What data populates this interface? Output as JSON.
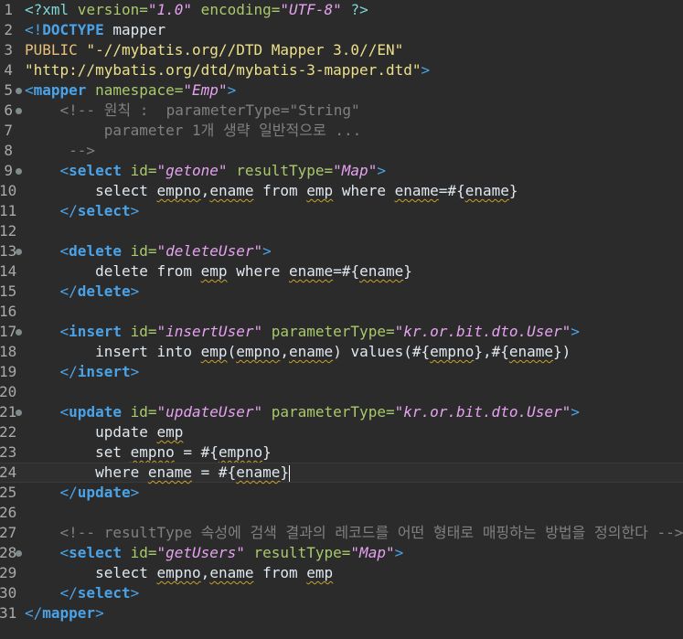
{
  "editor": {
    "lines": [
      {
        "n": "1",
        "fold": false,
        "tokens": [
          {
            "t": "<?",
            "c": "c-pi"
          },
          {
            "t": "xml",
            "c": "c-pi"
          },
          {
            "t": " version=",
            "c": "c-attr"
          },
          {
            "t": "\"1.0\"",
            "c": "c-val"
          },
          {
            "t": " encoding=",
            "c": "c-attr"
          },
          {
            "t": "\"UTF-8\"",
            "c": "c-val"
          },
          {
            "t": " ?>",
            "c": "c-pi"
          }
        ]
      },
      {
        "n": "2",
        "fold": false,
        "tokens": [
          {
            "t": "<!",
            "c": "c-br"
          },
          {
            "t": "DOCTYPE",
            "c": "c-tag"
          },
          {
            "t": " mapper",
            "c": "c-name"
          }
        ]
      },
      {
        "n": "3",
        "fold": false,
        "tokens": [
          {
            "t": "PUBLIC ",
            "c": "c-kw"
          },
          {
            "t": "\"-//mybatis.org//DTD Mapper 3.0//EN\"",
            "c": "c-str"
          }
        ]
      },
      {
        "n": "4",
        "fold": false,
        "tokens": [
          {
            "t": "\"http://mybatis.org/dtd/mybatis-3-mapper.dtd\"",
            "c": "c-str"
          },
          {
            "t": ">",
            "c": "c-br"
          }
        ]
      },
      {
        "n": "5",
        "fold": true,
        "tokens": [
          {
            "t": "<",
            "c": "c-br"
          },
          {
            "t": "mapper",
            "c": "c-tag"
          },
          {
            "t": " namespace=",
            "c": "c-attr"
          },
          {
            "t": "\"Emp\"",
            "c": "c-val"
          },
          {
            "t": ">",
            "c": "c-br"
          }
        ]
      },
      {
        "n": "6",
        "fold": true,
        "tokens": [
          {
            "t": "    <!-- 원칙 :  parameterType=\"String\"",
            "c": "c-cmt"
          }
        ]
      },
      {
        "n": "7",
        "fold": false,
        "tokens": [
          {
            "t": "         parameter 1개 생략 일반적으로 ...",
            "c": "c-cmt"
          }
        ]
      },
      {
        "n": "8",
        "fold": false,
        "tokens": [
          {
            "t": "     -->",
            "c": "c-cmt"
          }
        ]
      },
      {
        "n": "9",
        "fold": true,
        "tokens": [
          {
            "t": "    <",
            "c": "c-br"
          },
          {
            "t": "select",
            "c": "c-tag"
          },
          {
            "t": " id=",
            "c": "c-attr"
          },
          {
            "t": "\"getone\"",
            "c": "c-val"
          },
          {
            "t": " resultType=",
            "c": "c-attr"
          },
          {
            "t": "\"Map\"",
            "c": "c-val"
          },
          {
            "t": ">",
            "c": "c-br"
          }
        ]
      },
      {
        "n": "10",
        "fold": false,
        "tokens": [
          {
            "t": "        select ",
            "c": "c-sql"
          },
          {
            "t": "empno",
            "c": "c-sql u"
          },
          {
            "t": ",",
            "c": "c-sql"
          },
          {
            "t": "ename",
            "c": "c-sql u"
          },
          {
            "t": " from ",
            "c": "c-sql"
          },
          {
            "t": "emp",
            "c": "c-sql u"
          },
          {
            "t": " where ",
            "c": "c-sql"
          },
          {
            "t": "ename",
            "c": "c-sql u"
          },
          {
            "t": "=#{",
            "c": "c-sql"
          },
          {
            "t": "ename",
            "c": "c-sql u"
          },
          {
            "t": "}",
            "c": "c-sql"
          }
        ]
      },
      {
        "n": "11",
        "fold": false,
        "tokens": [
          {
            "t": "    </",
            "c": "c-br"
          },
          {
            "t": "select",
            "c": "c-tag"
          },
          {
            "t": ">",
            "c": "c-br"
          }
        ]
      },
      {
        "n": "12",
        "fold": false,
        "tokens": []
      },
      {
        "n": "13",
        "fold": true,
        "tokens": [
          {
            "t": "    <",
            "c": "c-br"
          },
          {
            "t": "delete",
            "c": "c-tag"
          },
          {
            "t": " id=",
            "c": "c-attr"
          },
          {
            "t": "\"deleteUser\"",
            "c": "c-val"
          },
          {
            "t": ">",
            "c": "c-br"
          }
        ]
      },
      {
        "n": "14",
        "fold": false,
        "tokens": [
          {
            "t": "        delete from ",
            "c": "c-sql"
          },
          {
            "t": "emp",
            "c": "c-sql u"
          },
          {
            "t": " where ",
            "c": "c-sql"
          },
          {
            "t": "ename",
            "c": "c-sql u"
          },
          {
            "t": "=#{",
            "c": "c-sql"
          },
          {
            "t": "ename",
            "c": "c-sql u"
          },
          {
            "t": "}",
            "c": "c-sql"
          }
        ]
      },
      {
        "n": "15",
        "fold": false,
        "tokens": [
          {
            "t": "    </",
            "c": "c-br"
          },
          {
            "t": "delete",
            "c": "c-tag"
          },
          {
            "t": ">",
            "c": "c-br"
          }
        ]
      },
      {
        "n": "16",
        "fold": false,
        "tokens": []
      },
      {
        "n": "17",
        "fold": true,
        "tokens": [
          {
            "t": "    <",
            "c": "c-br"
          },
          {
            "t": "insert",
            "c": "c-tag"
          },
          {
            "t": " id=",
            "c": "c-attr"
          },
          {
            "t": "\"insertUser\"",
            "c": "c-val"
          },
          {
            "t": " parameterType=",
            "c": "c-attr"
          },
          {
            "t": "\"kr.or.bit.dto.User\"",
            "c": "c-val"
          },
          {
            "t": ">",
            "c": "c-br"
          }
        ]
      },
      {
        "n": "18",
        "fold": false,
        "tokens": [
          {
            "t": "        insert into ",
            "c": "c-sql"
          },
          {
            "t": "emp",
            "c": "c-sql u"
          },
          {
            "t": "(",
            "c": "c-sql"
          },
          {
            "t": "empno",
            "c": "c-sql u"
          },
          {
            "t": ",",
            "c": "c-sql"
          },
          {
            "t": "ename",
            "c": "c-sql u"
          },
          {
            "t": ") values(#{",
            "c": "c-sql"
          },
          {
            "t": "empno",
            "c": "c-sql u"
          },
          {
            "t": "},#{",
            "c": "c-sql"
          },
          {
            "t": "ename",
            "c": "c-sql u"
          },
          {
            "t": "})",
            "c": "c-sql"
          }
        ]
      },
      {
        "n": "19",
        "fold": false,
        "tokens": [
          {
            "t": "    </",
            "c": "c-br"
          },
          {
            "t": "insert",
            "c": "c-tag"
          },
          {
            "t": ">",
            "c": "c-br"
          }
        ]
      },
      {
        "n": "20",
        "fold": false,
        "tokens": []
      },
      {
        "n": "21",
        "fold": true,
        "tokens": [
          {
            "t": "    <",
            "c": "c-br"
          },
          {
            "t": "update",
            "c": "c-tag"
          },
          {
            "t": " id=",
            "c": "c-attr"
          },
          {
            "t": "\"updateUser\"",
            "c": "c-val"
          },
          {
            "t": " parameterType=",
            "c": "c-attr"
          },
          {
            "t": "\"kr.or.bit.dto.User\"",
            "c": "c-val"
          },
          {
            "t": ">",
            "c": "c-br"
          }
        ]
      },
      {
        "n": "22",
        "fold": false,
        "tokens": [
          {
            "t": "        update ",
            "c": "c-sql"
          },
          {
            "t": "emp",
            "c": "c-sql u"
          }
        ]
      },
      {
        "n": "23",
        "fold": false,
        "tokens": [
          {
            "t": "        set ",
            "c": "c-sql"
          },
          {
            "t": "empno",
            "c": "c-sql u"
          },
          {
            "t": " = #{",
            "c": "c-sql"
          },
          {
            "t": "empno",
            "c": "c-sql u"
          },
          {
            "t": "}",
            "c": "c-sql"
          }
        ]
      },
      {
        "n": "24",
        "fold": false,
        "current": true,
        "tokens": [
          {
            "t": "        where ",
            "c": "c-sql"
          },
          {
            "t": "ename",
            "c": "c-sql u"
          },
          {
            "t": " = #{",
            "c": "c-sql"
          },
          {
            "t": "ename",
            "c": "c-sql u"
          },
          {
            "t": "}",
            "c": "c-sql"
          }
        ]
      },
      {
        "n": "25",
        "fold": false,
        "tokens": [
          {
            "t": "    </",
            "c": "c-br"
          },
          {
            "t": "update",
            "c": "c-tag"
          },
          {
            "t": ">",
            "c": "c-br"
          }
        ]
      },
      {
        "n": "26",
        "fold": false,
        "tokens": []
      },
      {
        "n": "27",
        "fold": false,
        "tokens": [
          {
            "t": "    <!-- resultType 속성에 검색 결과의 레코드를 어떤 형태로 매핑하는 방법을 정의한다 -->",
            "c": "c-cmt"
          }
        ]
      },
      {
        "n": "28",
        "fold": true,
        "tokens": [
          {
            "t": "    <",
            "c": "c-br"
          },
          {
            "t": "select",
            "c": "c-tag"
          },
          {
            "t": " id=",
            "c": "c-attr"
          },
          {
            "t": "\"getUsers\"",
            "c": "c-val"
          },
          {
            "t": " resultType=",
            "c": "c-attr"
          },
          {
            "t": "\"Map\"",
            "c": "c-val"
          },
          {
            "t": ">",
            "c": "c-br"
          }
        ]
      },
      {
        "n": "29",
        "fold": false,
        "tokens": [
          {
            "t": "        select ",
            "c": "c-sql"
          },
          {
            "t": "empno",
            "c": "c-sql u"
          },
          {
            "t": ",",
            "c": "c-sql"
          },
          {
            "t": "ename",
            "c": "c-sql u"
          },
          {
            "t": " from ",
            "c": "c-sql"
          },
          {
            "t": "emp",
            "c": "c-sql u"
          }
        ]
      },
      {
        "n": "30",
        "fold": false,
        "tokens": [
          {
            "t": "    </",
            "c": "c-br"
          },
          {
            "t": "select",
            "c": "c-tag"
          },
          {
            "t": ">",
            "c": "c-br"
          }
        ]
      },
      {
        "n": "31",
        "fold": false,
        "tokens": [
          {
            "t": "</",
            "c": "c-br"
          },
          {
            "t": "mapper",
            "c": "c-tag"
          },
          {
            "t": ">",
            "c": "c-br"
          }
        ]
      }
    ]
  }
}
